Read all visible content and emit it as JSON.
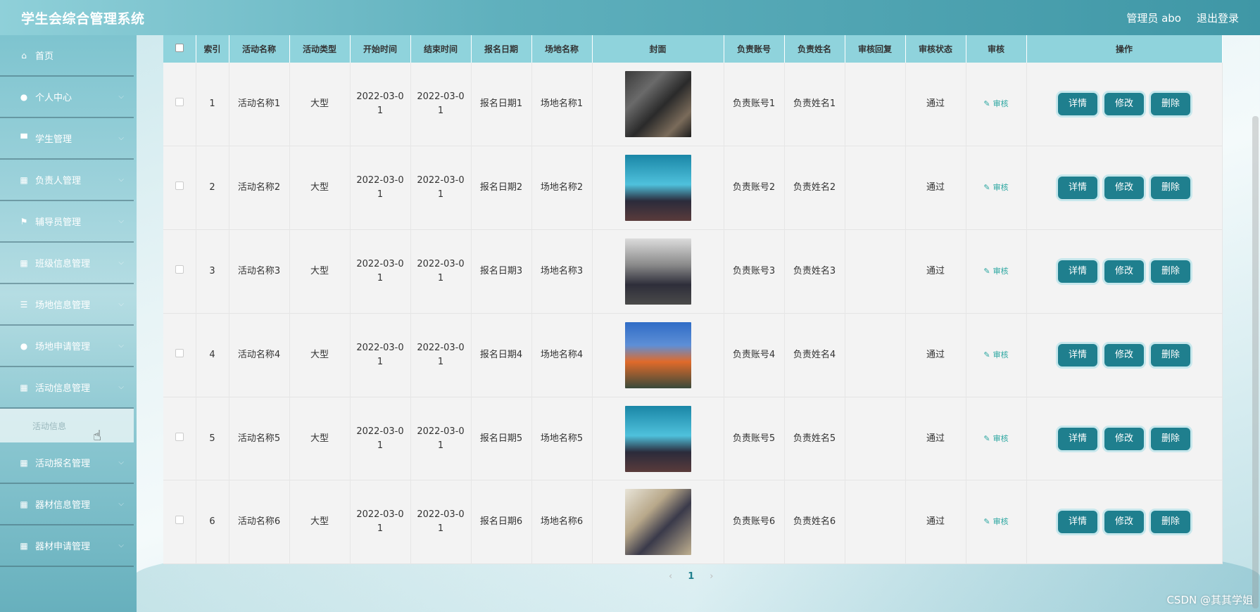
{
  "header": {
    "title": "学生会综合管理系统",
    "user_label": "管理员 abo",
    "logout_label": "退出登录"
  },
  "sidebar": {
    "items": [
      {
        "label": "首页",
        "icon": "home-icon",
        "glyph": "⌂"
      },
      {
        "label": "个人中心",
        "icon": "user-icon",
        "glyph": "●"
      },
      {
        "label": "学生管理",
        "icon": "chat-icon",
        "glyph": "▀"
      },
      {
        "label": "负责人管理",
        "icon": "grid-icon",
        "glyph": "▦"
      },
      {
        "label": "辅导员管理",
        "icon": "flag-icon",
        "glyph": "⚑"
      },
      {
        "label": "班级信息管理",
        "icon": "grid-icon",
        "glyph": "▦"
      },
      {
        "label": "场地信息管理",
        "icon": "list-icon",
        "glyph": "☰"
      },
      {
        "label": "场地申请管理",
        "icon": "pin-icon",
        "glyph": "●"
      },
      {
        "label": "活动信息管理",
        "icon": "grid-icon",
        "glyph": "▦"
      }
    ],
    "submenu_label": "活动信息",
    "items_after": [
      {
        "label": "活动报名管理",
        "icon": "grid-icon",
        "glyph": "▦"
      },
      {
        "label": "器材信息管理",
        "icon": "grid-icon",
        "glyph": "▦"
      },
      {
        "label": "器材申请管理",
        "icon": "grid-icon",
        "glyph": "▦"
      }
    ]
  },
  "table": {
    "columns": [
      "索引",
      "活动名称",
      "活动类型",
      "开始时间",
      "结束时间",
      "报名日期",
      "场地名称",
      "封面",
      "负责账号",
      "负责姓名",
      "审核回复",
      "审核状态",
      "审核",
      "操作"
    ],
    "audit_link": "审核",
    "actions": {
      "detail": "详情",
      "edit": "修改",
      "delete": "删除"
    },
    "rows": [
      {
        "index": "1",
        "name": "活动名称1",
        "type": "大型",
        "start": "2022-03-01",
        "end": "2022-03-01",
        "signup": "报名日期1",
        "venue": "场地名称1",
        "account": "负责账号1",
        "person": "负责姓名1",
        "reply": "",
        "status": "通过"
      },
      {
        "index": "2",
        "name": "活动名称2",
        "type": "大型",
        "start": "2022-03-01",
        "end": "2022-03-01",
        "signup": "报名日期2",
        "venue": "场地名称2",
        "account": "负责账号2",
        "person": "负责姓名2",
        "reply": "",
        "status": "通过"
      },
      {
        "index": "3",
        "name": "活动名称3",
        "type": "大型",
        "start": "2022-03-01",
        "end": "2022-03-01",
        "signup": "报名日期3",
        "venue": "场地名称3",
        "account": "负责账号3",
        "person": "负责姓名3",
        "reply": "",
        "status": "通过"
      },
      {
        "index": "4",
        "name": "活动名称4",
        "type": "大型",
        "start": "2022-03-01",
        "end": "2022-03-01",
        "signup": "报名日期4",
        "venue": "场地名称4",
        "account": "负责账号4",
        "person": "负责姓名4",
        "reply": "",
        "status": "通过"
      },
      {
        "index": "5",
        "name": "活动名称5",
        "type": "大型",
        "start": "2022-03-01",
        "end": "2022-03-01",
        "signup": "报名日期5",
        "venue": "场地名称5",
        "account": "负责账号5",
        "person": "负责姓名5",
        "reply": "",
        "status": "通过"
      },
      {
        "index": "6",
        "name": "活动名称6",
        "type": "大型",
        "start": "2022-03-01",
        "end": "2022-03-01",
        "signup": "报名日期6",
        "venue": "场地名称6",
        "account": "负责账号6",
        "person": "负责姓名6",
        "reply": "",
        "status": "通过"
      }
    ]
  },
  "pagination": {
    "prev": "‹",
    "current": "1",
    "next": "›"
  },
  "watermark": "CSDN @其其学姐"
}
